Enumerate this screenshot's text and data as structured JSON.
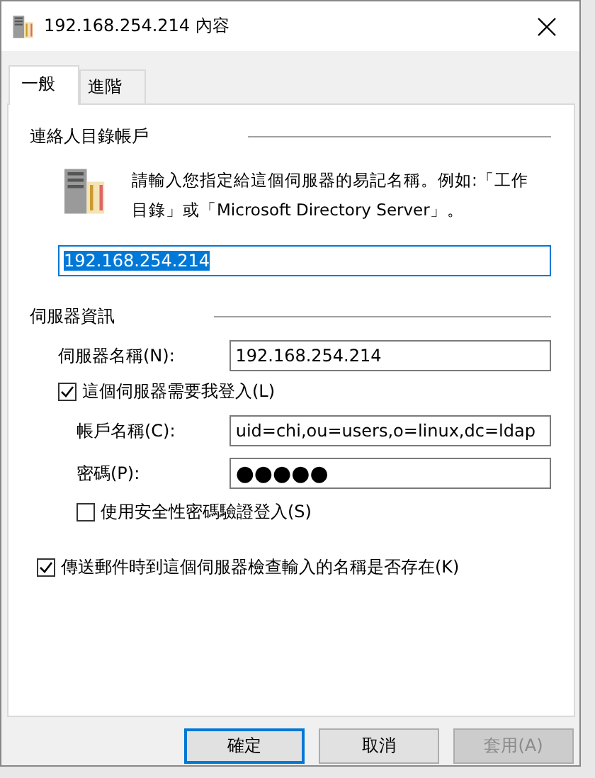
{
  "window": {
    "title": "192.168.254.214 內容"
  },
  "tabs": [
    {
      "label": "一般",
      "selected": true
    },
    {
      "label": "進階",
      "selected": false
    }
  ],
  "contact_section": {
    "heading": "連絡人目錄帳戶",
    "description": "請輸入您指定給這個伺服器的易記名稱。例如:「工作目錄」或「Microsoft Directory Server」。",
    "display_name": {
      "value": "192.168.254.214",
      "text_selected": true
    }
  },
  "server_section": {
    "heading": "伺服器資訊",
    "server_name": {
      "label": "伺服器名稱(N):",
      "value": "192.168.254.214"
    },
    "login_required": {
      "label": "這個伺服器需要我登入(L)",
      "checked": true
    },
    "account": {
      "label": "帳戶名稱(C):",
      "value": "uid=chi,ou=users,o=linux,dc=ldap"
    },
    "password": {
      "label": "密碼(P):",
      "value": "●●●●●"
    },
    "spa": {
      "label": "使用安全性密碼驗證登入(S)",
      "checked": false
    }
  },
  "check_names": {
    "label": "傳送郵件時到這個伺服器檢查輸入的名稱是否存在(K)",
    "checked": true
  },
  "buttons": [
    {
      "label": "確定",
      "default": true,
      "disabled": false
    },
    {
      "label": "取消",
      "default": false,
      "disabled": false
    },
    {
      "label": "套用(A)",
      "default": false,
      "disabled": true
    }
  ]
}
